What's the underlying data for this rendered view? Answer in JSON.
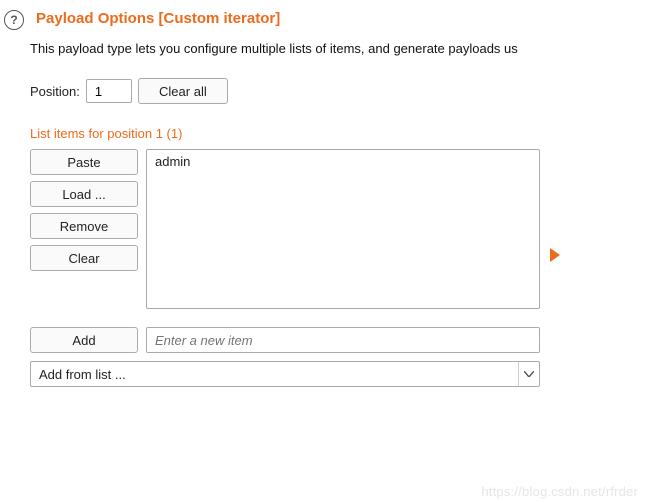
{
  "help_glyph": "?",
  "heading": "Payload Options [Custom iterator]",
  "description": "This payload type lets you configure multiple lists of items, and generate payloads us",
  "position": {
    "label": "Position:",
    "value": "1",
    "clear_all": "Clear all"
  },
  "sub_heading": "List items for position 1 (1)",
  "buttons": {
    "paste": "Paste",
    "load": "Load ...",
    "remove": "Remove",
    "clear": "Clear",
    "add": "Add"
  },
  "list_items": [
    "admin"
  ],
  "new_item_placeholder": "Enter a new item",
  "dropdown_label": "Add from list ...",
  "watermark": "https://blog.csdn.net/rfrder"
}
